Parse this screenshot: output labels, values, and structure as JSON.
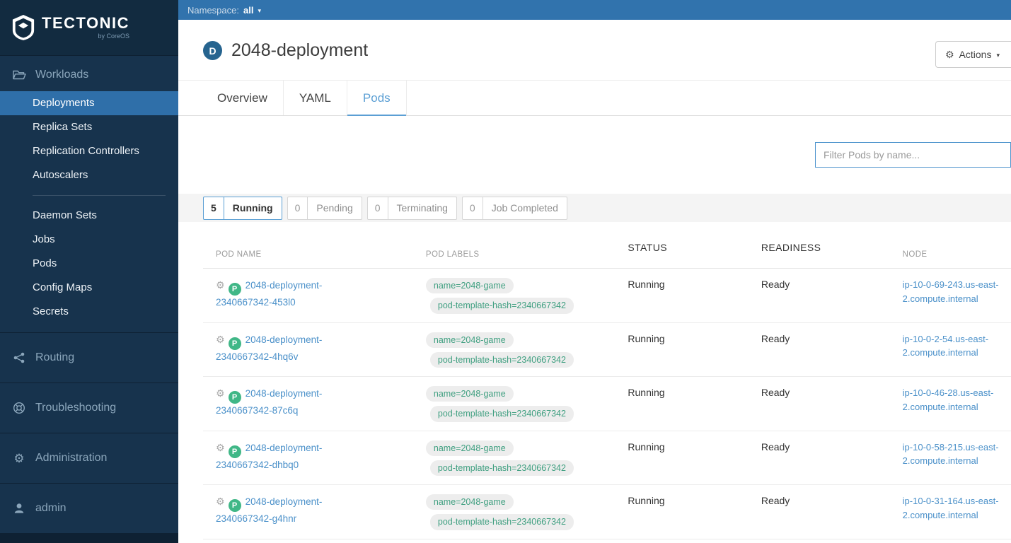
{
  "icons": {
    "gear": "⚙",
    "caret_down": "▾",
    "pod_badge": "P"
  },
  "sidebar": {
    "logo_title": "TECTONIC",
    "logo_subtitle": "by CoreOS",
    "workloads_label": "Workloads",
    "workloads_items": [
      "Deployments",
      "Replica Sets",
      "Replication Controllers",
      "Autoscalers",
      "Daemon Sets",
      "Jobs",
      "Pods",
      "Config Maps",
      "Secrets"
    ],
    "sections": [
      {
        "label": "Routing"
      },
      {
        "label": "Troubleshooting"
      },
      {
        "label": "Administration"
      },
      {
        "label": "admin"
      }
    ]
  },
  "namespace_bar": {
    "label": "Namespace:",
    "value": "all"
  },
  "page": {
    "badge": "D",
    "title": "2048-deployment",
    "actions_label": "Actions"
  },
  "tabs": [
    {
      "label": "Overview"
    },
    {
      "label": "YAML"
    },
    {
      "label": "Pods",
      "active": true
    }
  ],
  "filter_placeholder": "Filter Pods by name...",
  "status_filters": [
    {
      "count": "5",
      "label": "Running",
      "active": true
    },
    {
      "count": "0",
      "label": "Pending",
      "active": false
    },
    {
      "count": "0",
      "label": "Terminating",
      "active": false
    },
    {
      "count": "0",
      "label": "Job Completed",
      "active": false
    }
  ],
  "table": {
    "headers": [
      "POD NAME",
      "POD LABELS",
      "STATUS",
      "READINESS",
      "NODE"
    ],
    "rows": [
      {
        "name": "2048-deployment-2340667342-453l0",
        "labels": [
          "name=2048-game",
          "pod-template-hash=2340667342"
        ],
        "status": "Running",
        "readiness": "Ready",
        "node": "ip-10-0-69-243.us-east-2.compute.internal"
      },
      {
        "name": "2048-deployment-2340667342-4hq6v",
        "labels": [
          "name=2048-game",
          "pod-template-hash=2340667342"
        ],
        "status": "Running",
        "readiness": "Ready",
        "node": "ip-10-0-2-54.us-east-2.compute.internal"
      },
      {
        "name": "2048-deployment-2340667342-87c6q",
        "labels": [
          "name=2048-game",
          "pod-template-hash=2340667342"
        ],
        "status": "Running",
        "readiness": "Ready",
        "node": "ip-10-0-46-28.us-east-2.compute.internal"
      },
      {
        "name": "2048-deployment-2340667342-dhbq0",
        "labels": [
          "name=2048-game",
          "pod-template-hash=2340667342"
        ],
        "status": "Running",
        "readiness": "Ready",
        "node": "ip-10-0-58-215.us-east-2.compute.internal"
      },
      {
        "name": "2048-deployment-2340667342-g4hnr",
        "labels": [
          "name=2048-game",
          "pod-template-hash=2340667342"
        ],
        "status": "Running",
        "readiness": "Ready",
        "node": "ip-10-0-31-164.us-east-2.compute.internal"
      }
    ]
  }
}
